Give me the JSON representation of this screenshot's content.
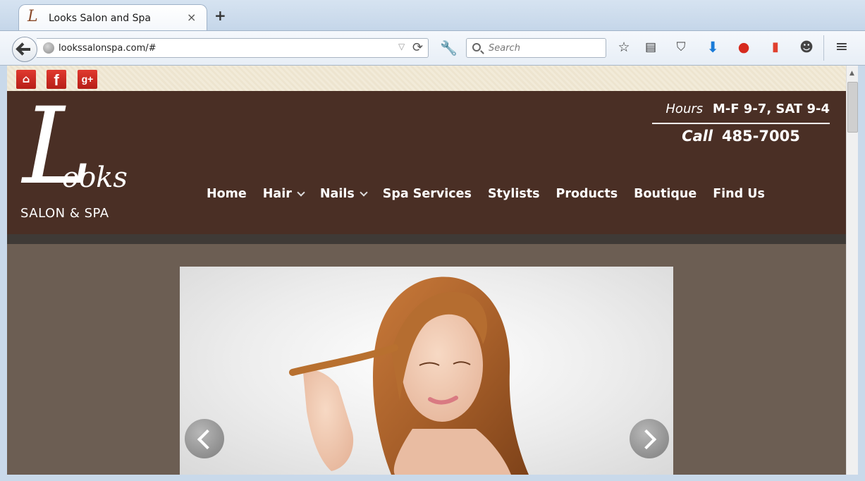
{
  "browser": {
    "tab_title": "Looks Salon and Spa",
    "tab_favicon_letter": "L",
    "tab_close": "×",
    "new_tab": "+",
    "url": "lookssalonspa.com/#",
    "search_placeholder": "Search",
    "icons": [
      "back-icon",
      "globe-icon",
      "reload-icon",
      "wrench-icon",
      "search-icon",
      "bookmark-star-icon",
      "reading-list-icon",
      "pocket-icon",
      "download-icon",
      "addon-red-icon",
      "addon-jar-icon",
      "chat-icon",
      "menu-icon"
    ]
  },
  "social": {
    "home": "⌂",
    "facebook": "f",
    "google_plus": "g+"
  },
  "logo": {
    "big_letter": "L",
    "rest": "ooks",
    "subtitle": "SALON & SPA"
  },
  "contact": {
    "hours_label": "Hours",
    "hours_value": "M-F 9-7, SAT 9-4",
    "call_label": "Call",
    "phone": "485-7005"
  },
  "nav": {
    "items": [
      {
        "label": "Home",
        "dropdown": false
      },
      {
        "label": "Hair",
        "dropdown": true
      },
      {
        "label": "Nails",
        "dropdown": true
      },
      {
        "label": "Spa Services",
        "dropdown": false
      },
      {
        "label": "Stylists",
        "dropdown": false
      },
      {
        "label": "Products",
        "dropdown": false
      },
      {
        "label": "Boutique",
        "dropdown": false
      },
      {
        "label": "Find Us",
        "dropdown": false
      }
    ]
  },
  "colors": {
    "header_brown": "#4a2f25",
    "page_bg": "#6c5e53",
    "social_red": "#d2302a"
  }
}
